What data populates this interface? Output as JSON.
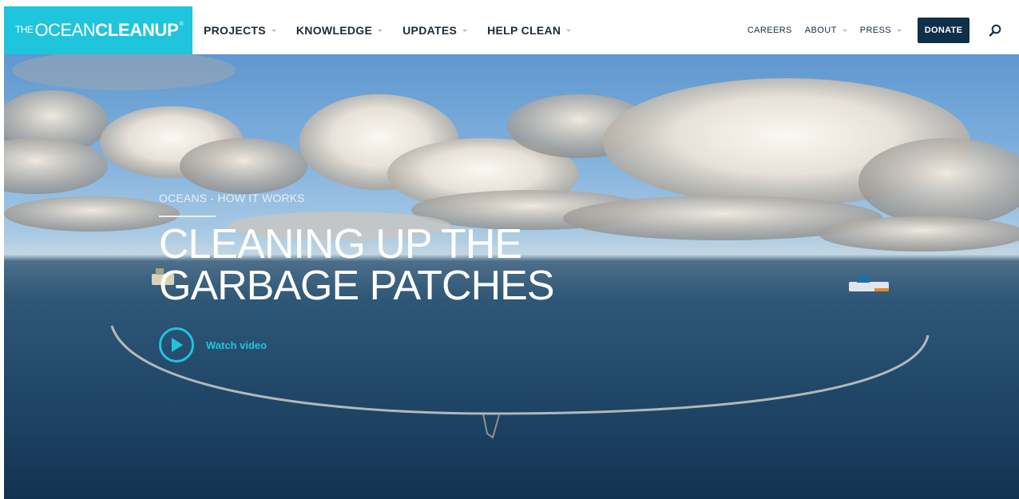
{
  "brand": {
    "the": "THE",
    "ocean": "OCEAN",
    "cleanup": "CLEANUP",
    "reg": "®"
  },
  "nav": {
    "main": [
      {
        "label": "PROJECTS"
      },
      {
        "label": "KNOWLEDGE"
      },
      {
        "label": "UPDATES"
      },
      {
        "label": "HELP CLEAN"
      }
    ],
    "secondary": [
      {
        "label": "CAREERS"
      },
      {
        "label": "ABOUT"
      },
      {
        "label": "PRESS"
      }
    ],
    "donate": "DONATE",
    "search_icon": "search-icon"
  },
  "hero": {
    "kicker": "OCEANS - HOW IT WORKS",
    "title_line1": "CLEANING UP THE",
    "title_line2": "GARBAGE PATCHES",
    "watch_label": "Watch video",
    "play_icon": "play-icon"
  },
  "colors": {
    "accent": "#1fc4dd",
    "navy": "#0f2f4a",
    "nav_text": "#1b2b3a"
  }
}
